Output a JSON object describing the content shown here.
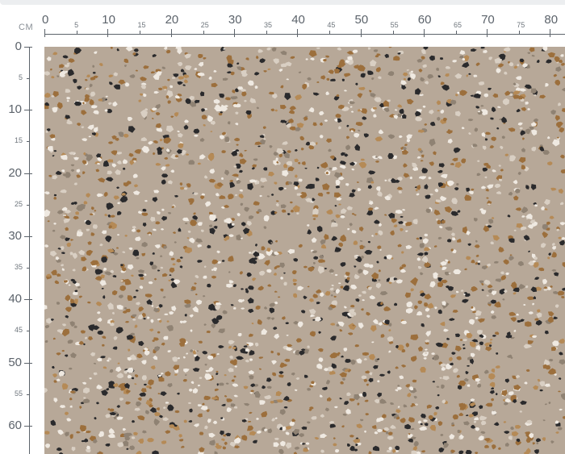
{
  "unit_label": "CM",
  "top_ruler": {
    "major_labels": [
      "0",
      "10",
      "20",
      "30",
      "40",
      "50",
      "60",
      "70",
      "80"
    ],
    "minor_labels": [
      "5",
      "15",
      "25",
      "35",
      "45",
      "55",
      "65",
      "75"
    ]
  },
  "left_ruler": {
    "major_labels": [
      "0",
      "10",
      "20",
      "30",
      "40",
      "50",
      "60"
    ],
    "minor_labels": [
      "5",
      "15",
      "25",
      "35",
      "45",
      "55"
    ]
  },
  "fabric": {
    "pattern": "terrazzo",
    "background_color": "#b7a898",
    "chip_colors": [
      "#2a2a2c",
      "#efe9e1",
      "#9c6f3c",
      "#8f8273",
      "#d9cfc3",
      "#b58a56"
    ]
  }
}
